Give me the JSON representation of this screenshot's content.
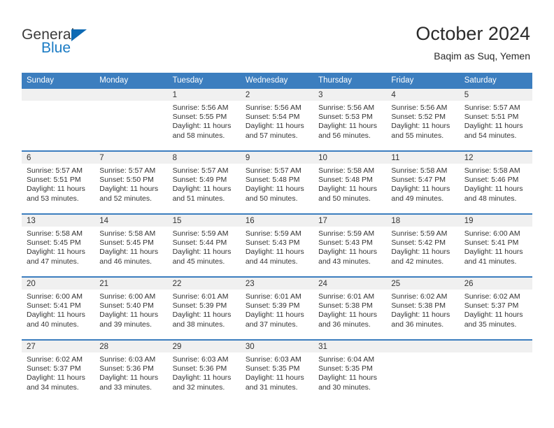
{
  "brand": {
    "name_part1": "General",
    "name_part2": "Blue",
    "triangle_color": "#0d6ab4",
    "blue_color": "#1a7bc4"
  },
  "header": {
    "title": "October 2024",
    "subtitle": "Baqim as Suq, Yemen",
    "accent_color": "#3c7ebf"
  },
  "calendar": {
    "weekday_headers": [
      "Sunday",
      "Monday",
      "Tuesday",
      "Wednesday",
      "Thursday",
      "Friday",
      "Saturday"
    ],
    "weeks": [
      [
        {
          "day": "",
          "sunrise": "",
          "sunset": "",
          "daylight_line1": "",
          "daylight_line2": ""
        },
        {
          "day": "",
          "sunrise": "",
          "sunset": "",
          "daylight_line1": "",
          "daylight_line2": ""
        },
        {
          "day": "1",
          "sunrise": "Sunrise: 5:56 AM",
          "sunset": "Sunset: 5:55 PM",
          "daylight_line1": "Daylight: 11 hours",
          "daylight_line2": "and 58 minutes."
        },
        {
          "day": "2",
          "sunrise": "Sunrise: 5:56 AM",
          "sunset": "Sunset: 5:54 PM",
          "daylight_line1": "Daylight: 11 hours",
          "daylight_line2": "and 57 minutes."
        },
        {
          "day": "3",
          "sunrise": "Sunrise: 5:56 AM",
          "sunset": "Sunset: 5:53 PM",
          "daylight_line1": "Daylight: 11 hours",
          "daylight_line2": "and 56 minutes."
        },
        {
          "day": "4",
          "sunrise": "Sunrise: 5:56 AM",
          "sunset": "Sunset: 5:52 PM",
          "daylight_line1": "Daylight: 11 hours",
          "daylight_line2": "and 55 minutes."
        },
        {
          "day": "5",
          "sunrise": "Sunrise: 5:57 AM",
          "sunset": "Sunset: 5:51 PM",
          "daylight_line1": "Daylight: 11 hours",
          "daylight_line2": "and 54 minutes."
        }
      ],
      [
        {
          "day": "6",
          "sunrise": "Sunrise: 5:57 AM",
          "sunset": "Sunset: 5:51 PM",
          "daylight_line1": "Daylight: 11 hours",
          "daylight_line2": "and 53 minutes."
        },
        {
          "day": "7",
          "sunrise": "Sunrise: 5:57 AM",
          "sunset": "Sunset: 5:50 PM",
          "daylight_line1": "Daylight: 11 hours",
          "daylight_line2": "and 52 minutes."
        },
        {
          "day": "8",
          "sunrise": "Sunrise: 5:57 AM",
          "sunset": "Sunset: 5:49 PM",
          "daylight_line1": "Daylight: 11 hours",
          "daylight_line2": "and 51 minutes."
        },
        {
          "day": "9",
          "sunrise": "Sunrise: 5:57 AM",
          "sunset": "Sunset: 5:48 PM",
          "daylight_line1": "Daylight: 11 hours",
          "daylight_line2": "and 50 minutes."
        },
        {
          "day": "10",
          "sunrise": "Sunrise: 5:58 AM",
          "sunset": "Sunset: 5:48 PM",
          "daylight_line1": "Daylight: 11 hours",
          "daylight_line2": "and 50 minutes."
        },
        {
          "day": "11",
          "sunrise": "Sunrise: 5:58 AM",
          "sunset": "Sunset: 5:47 PM",
          "daylight_line1": "Daylight: 11 hours",
          "daylight_line2": "and 49 minutes."
        },
        {
          "day": "12",
          "sunrise": "Sunrise: 5:58 AM",
          "sunset": "Sunset: 5:46 PM",
          "daylight_line1": "Daylight: 11 hours",
          "daylight_line2": "and 48 minutes."
        }
      ],
      [
        {
          "day": "13",
          "sunrise": "Sunrise: 5:58 AM",
          "sunset": "Sunset: 5:45 PM",
          "daylight_line1": "Daylight: 11 hours",
          "daylight_line2": "and 47 minutes."
        },
        {
          "day": "14",
          "sunrise": "Sunrise: 5:58 AM",
          "sunset": "Sunset: 5:45 PM",
          "daylight_line1": "Daylight: 11 hours",
          "daylight_line2": "and 46 minutes."
        },
        {
          "day": "15",
          "sunrise": "Sunrise: 5:59 AM",
          "sunset": "Sunset: 5:44 PM",
          "daylight_line1": "Daylight: 11 hours",
          "daylight_line2": "and 45 minutes."
        },
        {
          "day": "16",
          "sunrise": "Sunrise: 5:59 AM",
          "sunset": "Sunset: 5:43 PM",
          "daylight_line1": "Daylight: 11 hours",
          "daylight_line2": "and 44 minutes."
        },
        {
          "day": "17",
          "sunrise": "Sunrise: 5:59 AM",
          "sunset": "Sunset: 5:43 PM",
          "daylight_line1": "Daylight: 11 hours",
          "daylight_line2": "and 43 minutes."
        },
        {
          "day": "18",
          "sunrise": "Sunrise: 5:59 AM",
          "sunset": "Sunset: 5:42 PM",
          "daylight_line1": "Daylight: 11 hours",
          "daylight_line2": "and 42 minutes."
        },
        {
          "day": "19",
          "sunrise": "Sunrise: 6:00 AM",
          "sunset": "Sunset: 5:41 PM",
          "daylight_line1": "Daylight: 11 hours",
          "daylight_line2": "and 41 minutes."
        }
      ],
      [
        {
          "day": "20",
          "sunrise": "Sunrise: 6:00 AM",
          "sunset": "Sunset: 5:41 PM",
          "daylight_line1": "Daylight: 11 hours",
          "daylight_line2": "and 40 minutes."
        },
        {
          "day": "21",
          "sunrise": "Sunrise: 6:00 AM",
          "sunset": "Sunset: 5:40 PM",
          "daylight_line1": "Daylight: 11 hours",
          "daylight_line2": "and 39 minutes."
        },
        {
          "day": "22",
          "sunrise": "Sunrise: 6:01 AM",
          "sunset": "Sunset: 5:39 PM",
          "daylight_line1": "Daylight: 11 hours",
          "daylight_line2": "and 38 minutes."
        },
        {
          "day": "23",
          "sunrise": "Sunrise: 6:01 AM",
          "sunset": "Sunset: 5:39 PM",
          "daylight_line1": "Daylight: 11 hours",
          "daylight_line2": "and 37 minutes."
        },
        {
          "day": "24",
          "sunrise": "Sunrise: 6:01 AM",
          "sunset": "Sunset: 5:38 PM",
          "daylight_line1": "Daylight: 11 hours",
          "daylight_line2": "and 36 minutes."
        },
        {
          "day": "25",
          "sunrise": "Sunrise: 6:02 AM",
          "sunset": "Sunset: 5:38 PM",
          "daylight_line1": "Daylight: 11 hours",
          "daylight_line2": "and 36 minutes."
        },
        {
          "day": "26",
          "sunrise": "Sunrise: 6:02 AM",
          "sunset": "Sunset: 5:37 PM",
          "daylight_line1": "Daylight: 11 hours",
          "daylight_line2": "and 35 minutes."
        }
      ],
      [
        {
          "day": "27",
          "sunrise": "Sunrise: 6:02 AM",
          "sunset": "Sunset: 5:37 PM",
          "daylight_line1": "Daylight: 11 hours",
          "daylight_line2": "and 34 minutes."
        },
        {
          "day": "28",
          "sunrise": "Sunrise: 6:03 AM",
          "sunset": "Sunset: 5:36 PM",
          "daylight_line1": "Daylight: 11 hours",
          "daylight_line2": "and 33 minutes."
        },
        {
          "day": "29",
          "sunrise": "Sunrise: 6:03 AM",
          "sunset": "Sunset: 5:36 PM",
          "daylight_line1": "Daylight: 11 hours",
          "daylight_line2": "and 32 minutes."
        },
        {
          "day": "30",
          "sunrise": "Sunrise: 6:03 AM",
          "sunset": "Sunset: 5:35 PM",
          "daylight_line1": "Daylight: 11 hours",
          "daylight_line2": "and 31 minutes."
        },
        {
          "day": "31",
          "sunrise": "Sunrise: 6:04 AM",
          "sunset": "Sunset: 5:35 PM",
          "daylight_line1": "Daylight: 11 hours",
          "daylight_line2": "and 30 minutes."
        },
        {
          "day": "",
          "sunrise": "",
          "sunset": "",
          "daylight_line1": "",
          "daylight_line2": ""
        },
        {
          "day": "",
          "sunrise": "",
          "sunset": "",
          "daylight_line1": "",
          "daylight_line2": ""
        }
      ]
    ]
  }
}
